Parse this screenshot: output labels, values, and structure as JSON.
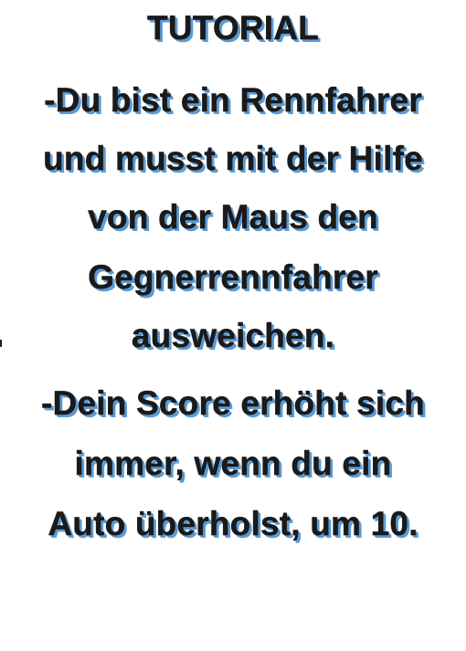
{
  "title": "TUTORIAL",
  "lines": [
    "-Du bist ein Rennfahrer",
    "und musst mit der Hilfe",
    "von der Maus den",
    "Gegnerrennfahrer",
    "ausweichen.",
    "-Dein Score erhöht sich",
    "immer, wenn du ein",
    "Auto überholst, um 10."
  ],
  "colors": {
    "text": "#1a1a1a",
    "shadow": "#5b9bd5",
    "background": "#ffffff"
  }
}
